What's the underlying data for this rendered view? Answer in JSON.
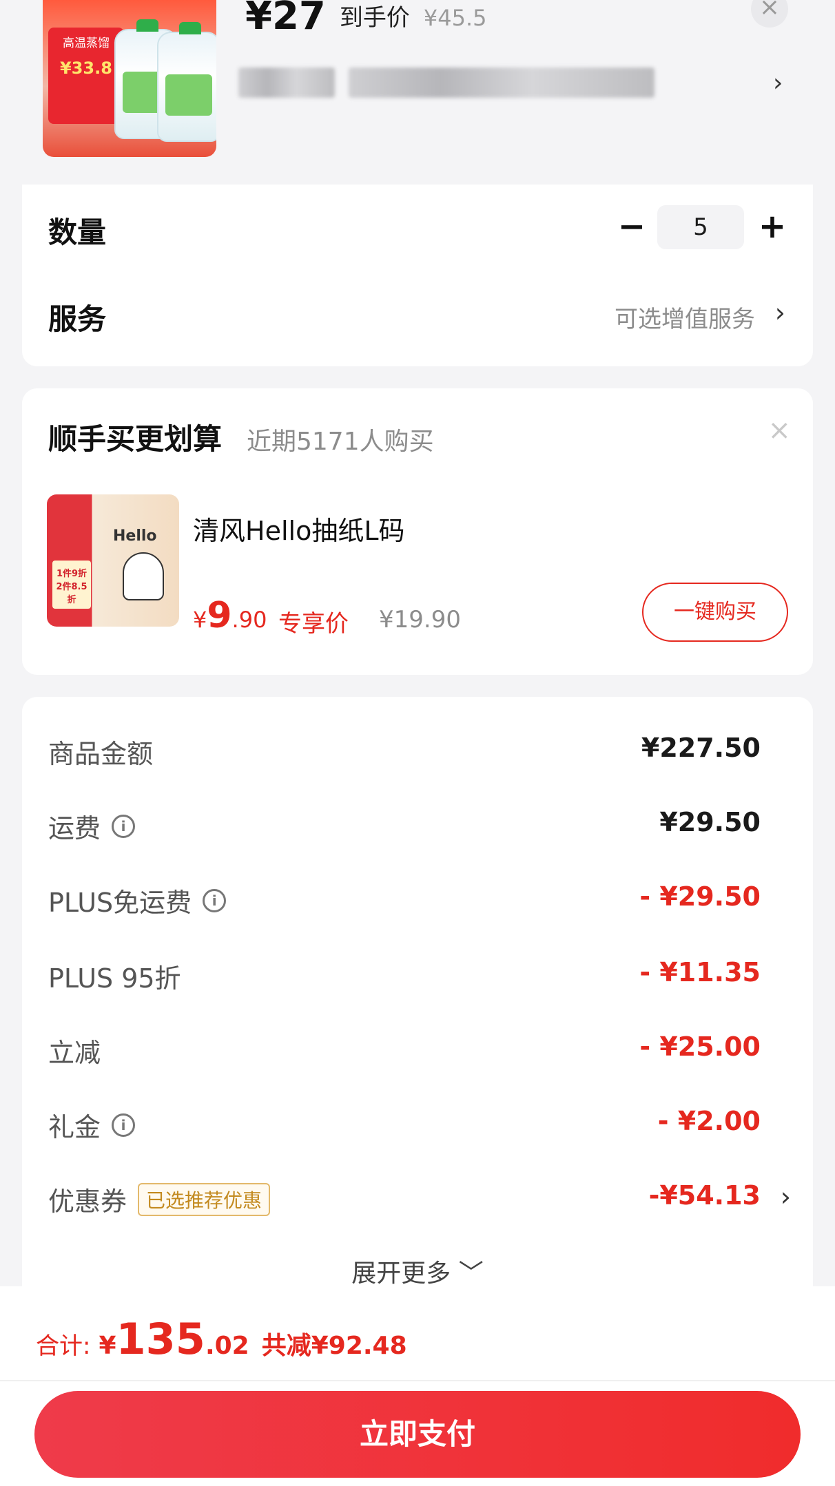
{
  "product": {
    "price_main": "¥27",
    "price_label": "到手价",
    "price_original": "¥45.5",
    "thumb_badge_title": "高温蒸馏",
    "thumb_badge_price": "¥33.8"
  },
  "quantity": {
    "label": "数量",
    "minus": "−",
    "value": "5",
    "plus": "+"
  },
  "service": {
    "label": "服务",
    "option_text": "可选增值服务",
    "chevron": "›"
  },
  "bundle": {
    "title": "顺手买更划算",
    "subtitle": "近期5171人购买",
    "close": "×",
    "item_name": "清风Hello抽纸L码",
    "price_currency": "¥",
    "price_int": "9",
    "price_dec": ".90",
    "price_tag": "专享价",
    "price_original": "¥19.90",
    "buy_button": "一键购买",
    "thumb_hello": "Hello",
    "thumb_tag": "1件9折 2件8.5折"
  },
  "fees": {
    "rows": [
      {
        "label": "商品金额",
        "value": "¥227.50",
        "info": false
      },
      {
        "label": "运费",
        "value": "¥29.50",
        "info": true
      },
      {
        "label": "PLUS免运费",
        "value": "- ¥29.50",
        "info": true
      },
      {
        "label": "PLUS 95折",
        "value": "- ¥11.35",
        "info": false
      },
      {
        "label": "立减",
        "value": "- ¥25.00",
        "info": false
      },
      {
        "label": "礼金",
        "value": "- ¥2.00",
        "info": true
      }
    ],
    "coupon": {
      "label": "优惠券",
      "badge": "已选推荐优惠",
      "value": "-¥54.13",
      "chevron": "›"
    },
    "expand_more": "展开更多 ﹀"
  },
  "footer": {
    "total_label": "合计:",
    "total_currency": "¥",
    "total_int": "135",
    "total_dec": ".02",
    "total_saved": "共减¥92.48",
    "pay_button": "立即支付"
  },
  "icons": {
    "info": "info-icon",
    "close": "close-icon",
    "chevron": "chevron-right-icon"
  },
  "colors": {
    "accent_red": "#e5281f",
    "button_gradient_start": "#ef3b4a",
    "button_gradient_end": "#f02c2c",
    "coupon_badge": "#c38a1f"
  }
}
